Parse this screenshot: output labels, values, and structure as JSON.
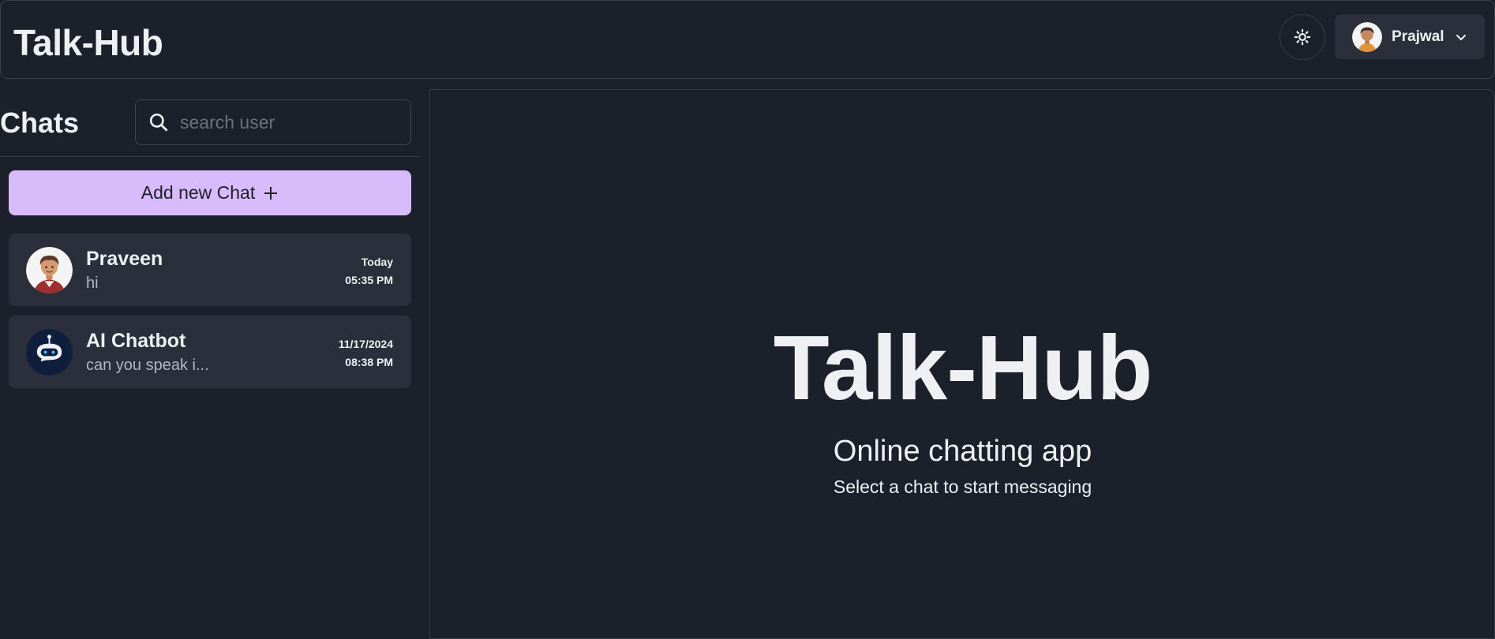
{
  "header": {
    "app_title": "Talk-Hub",
    "user_name": "Prajwal"
  },
  "sidebar": {
    "title": "Chats",
    "search_placeholder": "search user",
    "add_chat_label": "Add new Chat",
    "chats": [
      {
        "name": "Praveen",
        "last_message": "hi",
        "date": "Today",
        "time": "05:35 PM",
        "avatar": "person-avatar"
      },
      {
        "name": "AI Chatbot",
        "last_message": "can you speak i...",
        "date": "11/17/2024",
        "time": "08:38 PM",
        "avatar": "robot-avatar"
      }
    ]
  },
  "main": {
    "title": "Talk-Hub",
    "subtitle": "Online chatting app",
    "note": "Select a chat to start messaging"
  },
  "colors": {
    "background": "#1c202b",
    "card": "#2b2f3c",
    "accent": "#d7bbfb",
    "text": "#eef0f3"
  },
  "icons": [
    "sun-icon",
    "chevron-down-icon",
    "search-icon",
    "plus-icon"
  ]
}
